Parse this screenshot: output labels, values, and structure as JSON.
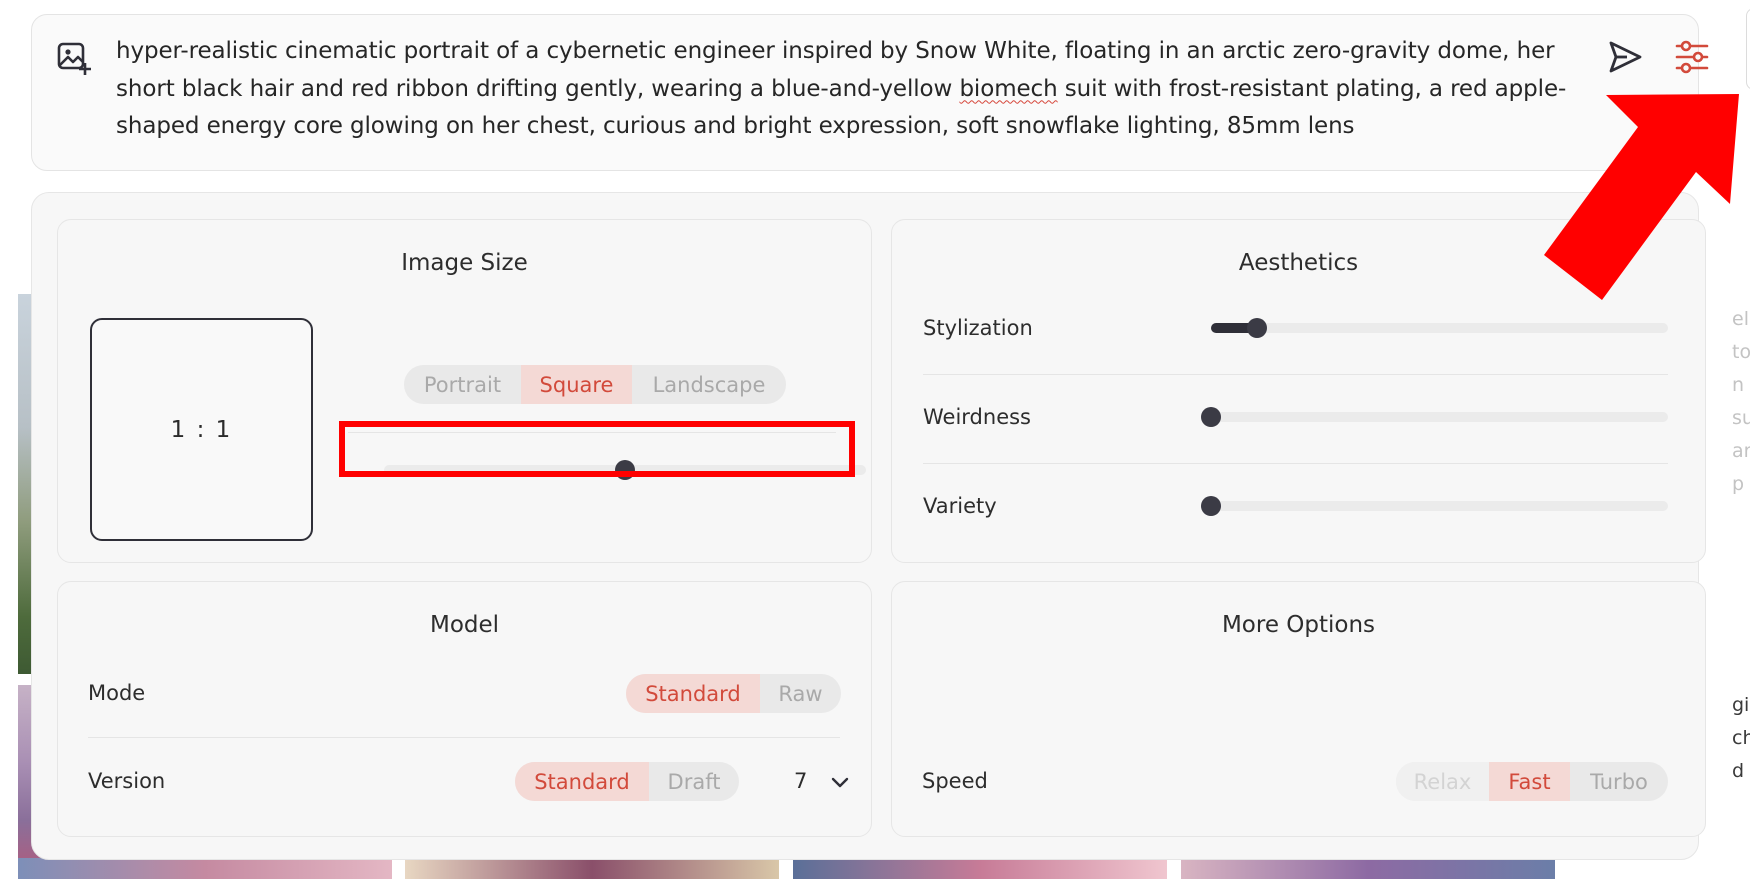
{
  "prompt": {
    "line1": "hyper-realistic cinematic portrait of a cybernetic engineer inspired by Snow White, floating in an arctic zero-gravity dome, her",
    "line2_before": "short black hair and red ribbon drifting gently, wearing a blue-and-yellow ",
    "line2_misspelled": "biomech",
    "line2_after": " suit with frost-resistant plating, a red apple-",
    "line3": "shaped energy core glowing on her chest, curious and bright expression, soft snowflake lighting, 85mm lens"
  },
  "icons": {
    "image_add": "image-add-icon",
    "send": "send-icon",
    "settings": "sliders-icon",
    "chevron": "chevron-down-icon"
  },
  "image_size": {
    "title": "Image Size",
    "ratio": "1 : 1",
    "orientation": [
      "Portrait",
      "Square",
      "Landscape"
    ],
    "selected_orientation": "Square",
    "aspect_slider_value": 0.5
  },
  "aesthetics": {
    "title": "Aesthetics",
    "sliders": [
      {
        "label": "Stylization",
        "value": 0.1
      },
      {
        "label": "Weirdness",
        "value": 0.0
      },
      {
        "label": "Variety",
        "value": 0.0
      }
    ]
  },
  "model": {
    "title": "Model",
    "mode_label": "Mode",
    "mode_options": [
      "Standard",
      "Raw"
    ],
    "mode_selected": "Standard",
    "version_label": "Version",
    "version_options": [
      "Standard",
      "Draft"
    ],
    "version_selected": "Standard",
    "version_number": "7"
  },
  "more_options": {
    "title": "More Options",
    "speed_label": "Speed",
    "speed_options": [
      "Relax",
      "Fast",
      "Turbo"
    ],
    "speed_selected": "Fast"
  },
  "background_text": {
    "lines": [
      "ele",
      "to",
      "n",
      "su",
      "ar",
      "p"
    ],
    "lines_dark": [
      "gi",
      "ch",
      "d"
    ]
  },
  "colors": {
    "accent": "#d24a3b",
    "accent_bg": "#f4d9d5",
    "annotation_red": "#ff0000"
  }
}
